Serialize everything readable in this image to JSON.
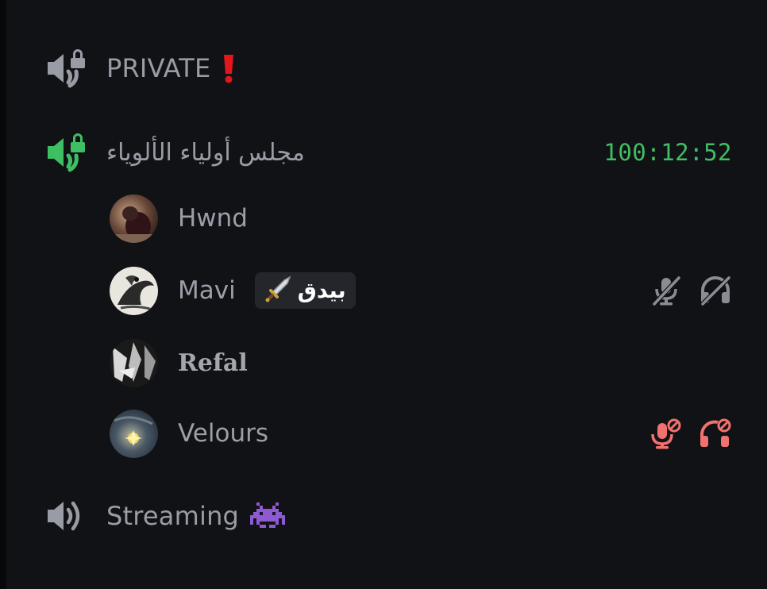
{
  "colors": {
    "background": "#111216",
    "channel_text": "#9a9ca5",
    "timer_green": "#3fbf63",
    "active_icon_green": "#3fbf63",
    "muted_red": "#f0716f",
    "muted_grey": "#8a8c94",
    "tag_bg": "#25262c"
  },
  "channels": [
    {
      "name": "PRIVATE",
      "emoji": "❗",
      "icon": "locked-speaker-icon",
      "active": false
    },
    {
      "name": "مجلس أولياء الألوياء",
      "icon": "locked-speaker-icon",
      "active": true,
      "timer": "100:12:52",
      "members": [
        {
          "name": "Hwnd",
          "avatar": "avatar-hwnd"
        },
        {
          "name": "Mavi",
          "avatar": "avatar-mavi",
          "tag": {
            "text": "بيدق",
            "icon": "sword-icon"
          },
          "status_icons": [
            "mic-muted-icon",
            "headphones-deafened-icon"
          ],
          "status_color": "grey"
        },
        {
          "name": "Refal",
          "avatar": "avatar-refal"
        },
        {
          "name": "Velours",
          "avatar": "avatar-velours",
          "status_icons": [
            "mic-server-muted-icon",
            "headphones-server-deafened-icon"
          ],
          "status_color": "red"
        }
      ]
    },
    {
      "name": "Streaming",
      "emoji": "👾",
      "icon": "speaker-icon",
      "active": false
    }
  ]
}
